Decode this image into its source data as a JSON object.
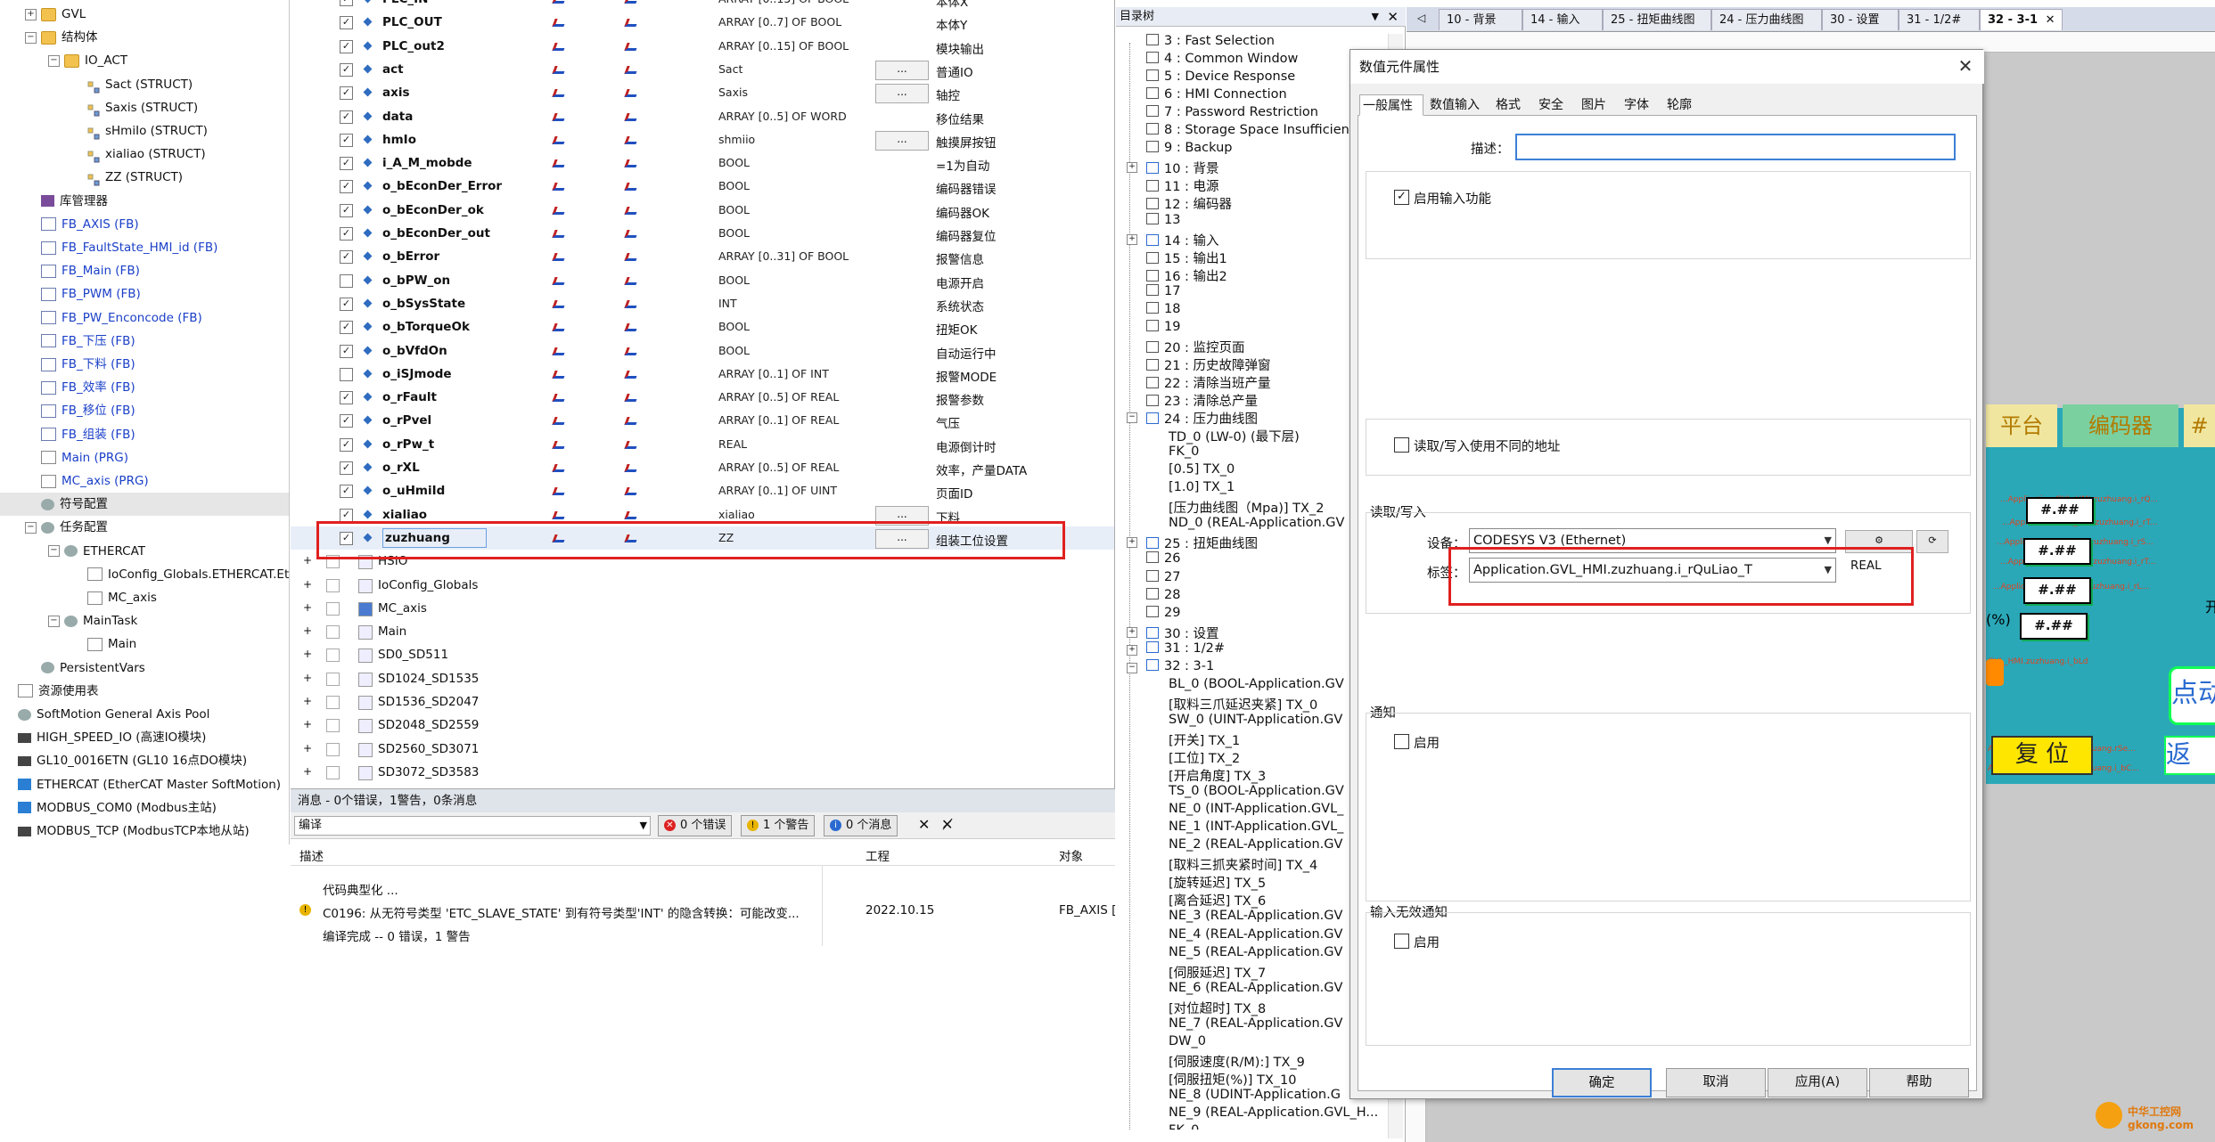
{
  "left_tree": [
    {
      "label": "GVL",
      "indent": 1,
      "icon": "folder",
      "exp": "+"
    },
    {
      "label": "结构体",
      "indent": 1,
      "icon": "folder",
      "exp": "-"
    },
    {
      "label": "IO_ACT",
      "indent": 2,
      "icon": "folder",
      "exp": "-"
    },
    {
      "label": "Sact (STRUCT)",
      "indent": 3,
      "icon": "struct"
    },
    {
      "label": "Saxis (STRUCT)",
      "indent": 3,
      "icon": "struct"
    },
    {
      "label": "sHmiIo (STRUCT)",
      "indent": 3,
      "icon": "struct"
    },
    {
      "label": "xialiao (STRUCT)",
      "indent": 3,
      "icon": "struct"
    },
    {
      "label": "ZZ (STRUCT)",
      "indent": 3,
      "icon": "struct"
    },
    {
      "label": "库管理器",
      "indent": 1,
      "icon": "lib"
    },
    {
      "label": "FB_AXIS (FB)",
      "indent": 1,
      "icon": "fb",
      "blue": true
    },
    {
      "label": "FB_FaultState_HMI_id (FB)",
      "indent": 1,
      "icon": "fb",
      "blue": true
    },
    {
      "label": "FB_Main (FB)",
      "indent": 1,
      "icon": "fb",
      "blue": true
    },
    {
      "label": "FB_PWM (FB)",
      "indent": 1,
      "icon": "fb",
      "blue": true
    },
    {
      "label": "FB_PW_Enconcode (FB)",
      "indent": 1,
      "icon": "fb",
      "blue": true
    },
    {
      "label": "FB_下压 (FB)",
      "indent": 1,
      "icon": "fb",
      "blue": true
    },
    {
      "label": "FB_下料 (FB)",
      "indent": 1,
      "icon": "fb",
      "blue": true
    },
    {
      "label": "FB_效率 (FB)",
      "indent": 1,
      "icon": "fb",
      "blue": true
    },
    {
      "label": "FB_移位 (FB)",
      "indent": 1,
      "icon": "fb",
      "blue": true
    },
    {
      "label": "FB_组装 (FB)",
      "indent": 1,
      "icon": "fb",
      "blue": true
    },
    {
      "label": "Main (PRG)",
      "indent": 1,
      "icon": "prg",
      "blue": true
    },
    {
      "label": "MC_axis (PRG)",
      "indent": 1,
      "icon": "prg",
      "blue": true
    },
    {
      "label": "符号配置",
      "indent": 1,
      "icon": "gear",
      "sel": true
    },
    {
      "label": "任务配置",
      "indent": 1,
      "icon": "gear",
      "exp": "-"
    },
    {
      "label": "ETHERCAT",
      "indent": 2,
      "icon": "gear",
      "exp": "-"
    },
    {
      "label": "IoConfig_Globals.ETHERCAT.Eth",
      "indent": 3,
      "icon": "prg"
    },
    {
      "label": "MC_axis",
      "indent": 3,
      "icon": "prg"
    },
    {
      "label": "MainTask",
      "indent": 2,
      "icon": "gear",
      "exp": "-"
    },
    {
      "label": "Main",
      "indent": 3,
      "icon": "prg"
    },
    {
      "label": "PersistentVars",
      "indent": 1,
      "icon": "gear"
    },
    {
      "label": "资源使用表",
      "indent": 0,
      "icon": "prg"
    },
    {
      "label": "SoftMotion General Axis Pool",
      "indent": 0,
      "icon": "gear"
    },
    {
      "label": "HIGH_SPEED_IO (高速IO模块)",
      "indent": 0,
      "icon": "dev"
    },
    {
      "label": "GL10_0016ETN (GL10 16点DO模块)",
      "indent": 0,
      "icon": "dev"
    },
    {
      "label": "ETHERCAT (EtherCAT Master SoftMotion)",
      "indent": 0,
      "icon": "eth"
    },
    {
      "label": "MODBUS_COM0 (Modbus主站)",
      "indent": 0,
      "icon": "eth"
    },
    {
      "label": "MODBUS_TCP (ModbusTCP本地从站)",
      "indent": 0,
      "icon": "dev"
    }
  ],
  "variables": [
    {
      "name": "PLC_IN",
      "type": "ARRAY [0..15] OF BOOL",
      "comment": "本体X",
      "checked": true
    },
    {
      "name": "PLC_OUT",
      "type": "ARRAY [0..7] OF BOOL",
      "comment": "本体Y",
      "checked": true
    },
    {
      "name": "PLC_out2",
      "type": "ARRAY [0..15] OF BOOL",
      "comment": "模块输出",
      "checked": true
    },
    {
      "name": "act",
      "type": "Sact",
      "comment": "普通IO",
      "checked": true,
      "dots": true
    },
    {
      "name": "axis",
      "type": "Saxis",
      "comment": "轴控",
      "checked": true,
      "dots": true
    },
    {
      "name": "data",
      "type": "ARRAY [0..5] OF WORD",
      "comment": "移位结果",
      "checked": true
    },
    {
      "name": "hmIo",
      "type": "shmiio",
      "comment": "触摸屏按钮",
      "checked": true,
      "dots": true
    },
    {
      "name": "i_A_M_mobde",
      "type": "BOOL",
      "comment": "=1为自动",
      "checked": true
    },
    {
      "name": "o_bEconDer_Error",
      "type": "BOOL",
      "comment": "编码器错误",
      "checked": true
    },
    {
      "name": "o_bEconDer_ok",
      "type": "BOOL",
      "comment": "编码器OK",
      "checked": true
    },
    {
      "name": "o_bEconDer_out",
      "type": "BOOL",
      "comment": "编码器复位",
      "checked": true
    },
    {
      "name": "o_bError",
      "type": "ARRAY [0..31] OF BOOL",
      "comment": "报警信息",
      "checked": true
    },
    {
      "name": "o_bPW_on",
      "type": "BOOL",
      "comment": "电源开启",
      "checked": false
    },
    {
      "name": "o_bSysState",
      "type": "INT",
      "comment": "系统状态",
      "checked": true
    },
    {
      "name": "o_bTorqueOk",
      "type": "BOOL",
      "comment": "扭矩OK",
      "checked": true
    },
    {
      "name": "o_bVfdOn",
      "type": "BOOL",
      "comment": "自动运行中",
      "checked": true
    },
    {
      "name": "o_iSJmode",
      "type": "ARRAY [0..1] OF INT",
      "comment": "报警MODE",
      "checked": false
    },
    {
      "name": "o_rFault",
      "type": "ARRAY [0..5] OF REAL",
      "comment": "报警参数",
      "checked": true
    },
    {
      "name": "o_rPvel",
      "type": "ARRAY [0..1] OF REAL",
      "comment": "气压",
      "checked": true
    },
    {
      "name": "o_rPw_t",
      "type": "REAL",
      "comment": "电源倒计时",
      "checked": true
    },
    {
      "name": "o_rXL",
      "type": "ARRAY [0..5] OF REAL",
      "comment": "效率，产量DATA",
      "checked": true
    },
    {
      "name": "o_uHmiId",
      "type": "ARRAY [0..1] OF UINT",
      "comment": "页面ID",
      "checked": true
    },
    {
      "name": "xialiao",
      "type": "xialiao",
      "comment": "下料",
      "checked": true,
      "dots": true
    },
    {
      "name": "zuzhuang",
      "type": "ZZ",
      "comment": "组装工位设置",
      "checked": true,
      "dots": true,
      "selected": true
    }
  ],
  "sub_items": [
    "HSIO",
    "IoConfig_Globals",
    "MC_axis",
    "Main",
    "SD0_SD511",
    "SD1024_SD1535",
    "SD1536_SD2047",
    "SD2048_SD2559",
    "SD2560_SD3071",
    "SD3072_SD3583"
  ],
  "messages": {
    "title": "消息 - 0个错误，1警告，0条消息",
    "filter": "编译",
    "errors": "0 个错误",
    "warnings": "1 个警告",
    "infos": "0 个消息",
    "col_desc": "描述",
    "col_project": "工程",
    "col_object": "对象",
    "rows": [
      {
        "desc": "代码典型化 ...",
        "project": "",
        "object": ""
      },
      {
        "desc": "C0196: 从无符号类型 'ETC_SLAVE_STATE' 到有符号类型'INT' 的隐含转换：可能改变...",
        "project": "2022.10.15",
        "object": "FB_AXIS [D"
      },
      {
        "desc": "编译完成 -- 0 错误，1 警告",
        "project": "",
        "object": ""
      }
    ]
  },
  "dir_tree": {
    "title": "目录树",
    "items": [
      {
        "label": "3 : Fast Selection"
      },
      {
        "label": "4 : Common Window"
      },
      {
        "label": "5 : Device Response"
      },
      {
        "label": "6 : HMI Connection"
      },
      {
        "label": "7 : Password Restriction"
      },
      {
        "label": "8 : Storage Space Insufficien"
      },
      {
        "label": "9 : Backup"
      },
      {
        "label": "10 : 背景",
        "exp": "+",
        "tv": true
      },
      {
        "label": "11 : 电源"
      },
      {
        "label": "12 : 编码器"
      },
      {
        "label": "13"
      },
      {
        "label": "14 : 输入",
        "exp": "+",
        "tv": true
      },
      {
        "label": "15 : 输出1"
      },
      {
        "label": "16 : 输出2"
      },
      {
        "label": "17"
      },
      {
        "label": "18"
      },
      {
        "label": "19"
      },
      {
        "label": "20 : 监控页面"
      },
      {
        "label": "21 : 历史故障弹窗"
      },
      {
        "label": "22 : 清除当班产量"
      },
      {
        "label": "23 : 清除总产量"
      },
      {
        "label": "24 : 压力曲线图",
        "exp": "-",
        "tv": true
      },
      {
        "label": "TD_0 (LW-0) (最下层)",
        "child": true
      },
      {
        "label": "FK_0",
        "child": true
      },
      {
        "label": "[0.5] TX_0",
        "child": true
      },
      {
        "label": "[1.0] TX_1",
        "child": true
      },
      {
        "label": "[压力曲线图（Mpa)] TX_2",
        "child": true
      },
      {
        "label": "ND_0 (REAL-Application.GV",
        "child": true
      },
      {
        "label": "25 : 扭矩曲线图",
        "exp": "+",
        "tv": true
      },
      {
        "label": "26"
      },
      {
        "label": "27"
      },
      {
        "label": "28"
      },
      {
        "label": "29"
      },
      {
        "label": "30 : 设置",
        "exp": "+",
        "tv": true
      },
      {
        "label": "31 : 1/2#",
        "exp": "+",
        "tv": true
      },
      {
        "label": "32 : 3-1",
        "exp": "-",
        "tv": true
      },
      {
        "label": "BL_0 (BOOL-Application.GV",
        "child": true
      },
      {
        "label": "[取料三爪延迟夹紧] TX_0",
        "child": true
      },
      {
        "label": "SW_0 (UINT-Application.GV",
        "child": true
      },
      {
        "label": "[开关] TX_1",
        "child": true
      },
      {
        "label": "[工位] TX_2",
        "child": true
      },
      {
        "label": "[开启角度] TX_3",
        "child": true
      },
      {
        "label": "TS_0 (BOOL-Application.GV",
        "child": true
      },
      {
        "label": "NE_0 (INT-Application.GVL_",
        "child": true
      },
      {
        "label": "NE_1 (INT-Application.GVL_",
        "child": true
      },
      {
        "label": "NE_2 (REAL-Application.GV",
        "child": true
      },
      {
        "label": "[取料三抓夹紧时间] TX_4",
        "child": true
      },
      {
        "label": "[旋转延迟] TX_5",
        "child": true
      },
      {
        "label": "[离合延迟] TX_6",
        "child": true
      },
      {
        "label": "NE_3 (REAL-Application.GV",
        "child": true
      },
      {
        "label": "NE_4 (REAL-Application.GV",
        "child": true
      },
      {
        "label": "NE_5 (REAL-Application.GV",
        "child": true
      },
      {
        "label": "[伺服延迟] TX_7",
        "child": true
      },
      {
        "label": "NE_6 (REAL-Application.GV",
        "child": true
      },
      {
        "label": "[对位超时] TX_8",
        "child": true
      },
      {
        "label": "NE_7 (REAL-Application.GV",
        "child": true
      },
      {
        "label": "DW_0",
        "child": true
      },
      {
        "label": "[伺服速度(R/M):] TX_9",
        "child": true
      },
      {
        "label": "[伺服扭矩(%)] TX_10",
        "child": true
      },
      {
        "label": "NE_8 (UDINT-Application.G",
        "child": true
      },
      {
        "label": "NE_9 (REAL-Application.GVL_H...",
        "child": true
      },
      {
        "label": "FK_0",
        "child": true
      }
    ]
  },
  "tabs": [
    {
      "label": "10 - 背景"
    },
    {
      "label": "14 - 输入"
    },
    {
      "label": "25 - 扭矩曲线图"
    },
    {
      "label": "24 - 压力曲线图"
    },
    {
      "label": "30 - 设置"
    },
    {
      "label": "31 - 1/2#"
    },
    {
      "label": "32 - 3-1",
      "active": true
    }
  ],
  "hmi": {
    "bar1": "平台",
    "bar2": "编码器",
    "bar3": "#",
    "num": "#.##",
    "btn_point": "点动",
    "btn_reset": "复 位",
    "btn_back": "返",
    "side_char": "开",
    "pct": "(%)",
    "red_lines": [
      "...Application.GVL_HMI.zuzhuang.i_rQ...",
      "...Application.GVL_HMI.zuzhuang.i_rT...",
      "...Application.GVL_HMI.zuzhuang.i_rS...",
      "...Application.GVL_HMI.zuzhuang.i_rT...",
      "...Application.GVL_HMI.zuzhuang.i_rL...",
      "GVL_HMI.zuzhuang.i_bLd",
      "Application.GVL_HMI.zuzhuang.rSe...",
      "Application.GVL_HMI.zuzhuang.i_bC..."
    ]
  },
  "dialog": {
    "title": "数值元件属性",
    "tabs": [
      "一般属性",
      "数值输入",
      "格式",
      "安全",
      "图片",
      "字体",
      "轮廓"
    ],
    "desc_label": "描述：",
    "desc_value": "",
    "enable_input_label": "启用输入功能",
    "enable_input_checked": true,
    "rw_diff_label": "读取/写入使用不同的地址",
    "rw_group_label": "读取/写入",
    "device_label": "设备：",
    "device_value": "CODESYS V3 (Ethernet)",
    "tag_label": "标签：",
    "tag_value": "Application.GVL_HMI.zuzhuang.i_rQuLiao_T",
    "tag_type": "REAL",
    "notify_label": "通知",
    "notify_enable": "启用",
    "invalid_label": "输入无效通知",
    "invalid_enable": "启用",
    "btn_ok": "确定",
    "btn_cancel": "取消",
    "btn_apply": "应用(A)",
    "btn_help": "帮助"
  },
  "watermark": "中华工控网 gkong.com",
  "colors": {
    "highlight": "#e02020",
    "hmi_bg": "#2aa8b8",
    "hmi_bar": "#f0e6a0",
    "selected_bg": "#e8eef8"
  }
}
